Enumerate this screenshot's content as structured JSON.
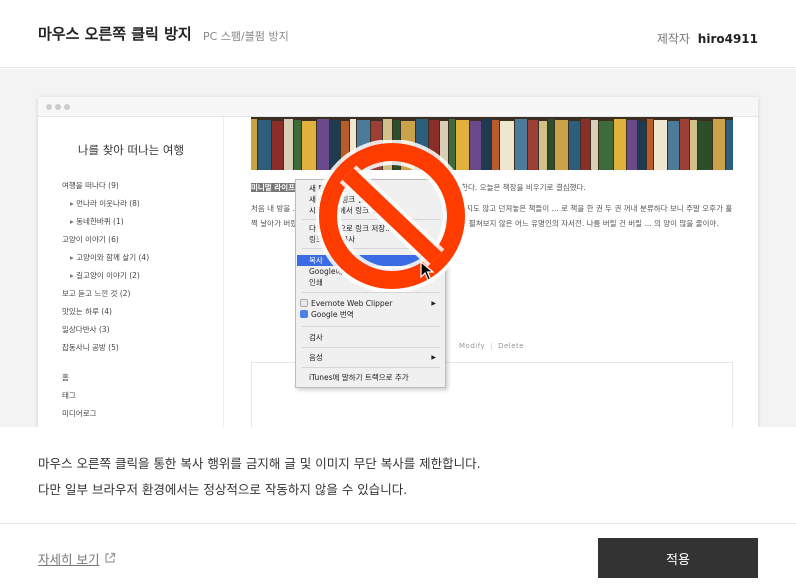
{
  "header": {
    "title": "마우스 오른쪽 클릭 방지",
    "subtitle": "PC 스팸/블펌 방지",
    "maker_label": "제작자",
    "maker_name": "hiro4911"
  },
  "preview": {
    "blog_title": "나를 찾아 떠나는 여행",
    "categories": [
      {
        "label": "여행을 떠나다 (9)",
        "sub": false
      },
      {
        "label": "먼나라 이웃나라 (8)",
        "sub": true
      },
      {
        "label": "동네한바퀴 (1)",
        "sub": true
      },
      {
        "label": "고양이 이야기 (6)",
        "sub": false
      },
      {
        "label": "고양이와 함께 살기 (4)",
        "sub": true
      },
      {
        "label": "길고양이 이야기 (2)",
        "sub": true
      },
      {
        "label": "보고 듣고 느낀 것 (2)",
        "sub": false
      },
      {
        "label": "맛있는 하루 (4)",
        "sub": false
      },
      {
        "label": "일상다반사 (3)",
        "sub": false
      },
      {
        "label": "잡동사니 공방 (5)",
        "sub": false
      },
      {
        "label": "홈",
        "sub": false
      },
      {
        "label": "태그",
        "sub": false
      },
      {
        "label": "미디어로그",
        "sub": false
      }
    ],
    "article": {
      "highlight": "미니멀 라이프",
      "p1": "를 실천하고자 청소하는 과정을 하나하나 남겨놓을까 한다. 오늘은 책장을 비우기로 결심했다.",
      "p2": "처음 내 방을 ... 서재의 이미지였을 텐데. 몇 년간 정리하지는 않고 읽지도 않고 던져놓은 책들이 ... 로 책을 한 권 두 권 꺼내 분류하다 보니 주말 오후가 훌쩍 날아가 버렸다. 때문은 동화... 중고 ...후감 숙제 때문에 한 번 읽고 펼쳐보지 않은 어느 유명인의 자서전. 나름 버릴 건 버릴 ... 의 양이 많을 줄이야."
    },
    "modify_label": "Modify",
    "delete_label": "Delete",
    "context_menu": {
      "items": [
        "새 탭에서 링크 열기",
        "새 창에서 링크 열기",
        "시크릿 창에서 링크 열기",
        "다른 이름으로 링크 저장...",
        "링크 주소 복사",
        "복사",
        "Google에서 '미니멀 라이프' 검색",
        "인쇄",
        "Evernote Web Clipper",
        "Google 번역",
        "검사",
        "음성",
        "iTunes에 말하기 트랙으로 추가"
      ]
    }
  },
  "description": {
    "line1": "마우스 오른쪽 클릭을 통한 복사 행위를 금지해 글 및 이미지 무단 복사를 제한합니다.",
    "line2": "다만 일부 브라우저 환경에서는 정상적으로 작동하지 않을 수 있습니다."
  },
  "footer": {
    "more_label": "자세히 보기",
    "apply_label": "적용"
  },
  "colors": {
    "apply_button": "#333333",
    "no_sign": "#ff3c00",
    "menu_highlight": "#3c6ce4"
  },
  "icons": [
    "external-link-icon",
    "no-entry-icon",
    "cursor-arrow-icon",
    "evernote-icon",
    "google-translate-icon"
  ]
}
